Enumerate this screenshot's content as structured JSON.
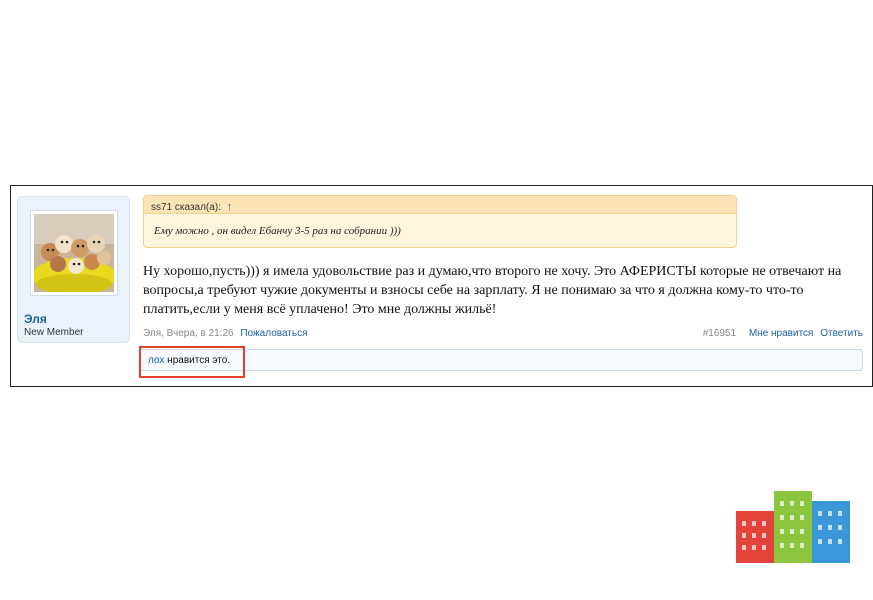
{
  "user": {
    "name": "Эля",
    "title": "New Member"
  },
  "quote": {
    "author": "ss71 сказал(а):",
    "arrow": "↑",
    "text": "Ему можно , он видел Ебанчу 3-5 раз на собрании )))"
  },
  "message": {
    "text": "Ну хорошо,пусть))) я имела удовольствие раз и думаю,что второго не хочу. Это АФЕРИСТЫ которые не отвечают на вопросы,а требуют чужие документы и взносы себе на зарплату. Я не понимаю за что я должна кому-то что-то платить,если у меня всё уплачено! Это мне должны жильё!"
  },
  "meta": {
    "author_time": "Эля, Вчера, в 21:26",
    "report": "Пожаловаться",
    "post_number": "#16951",
    "like": "Мне нравится",
    "reply": "Ответить"
  },
  "likes": {
    "user": "лох",
    "text": " нравится это."
  },
  "colors": {
    "link": "#1b5e9f",
    "highlight": "#e1412b",
    "quote_bg": "#fff4dc"
  }
}
